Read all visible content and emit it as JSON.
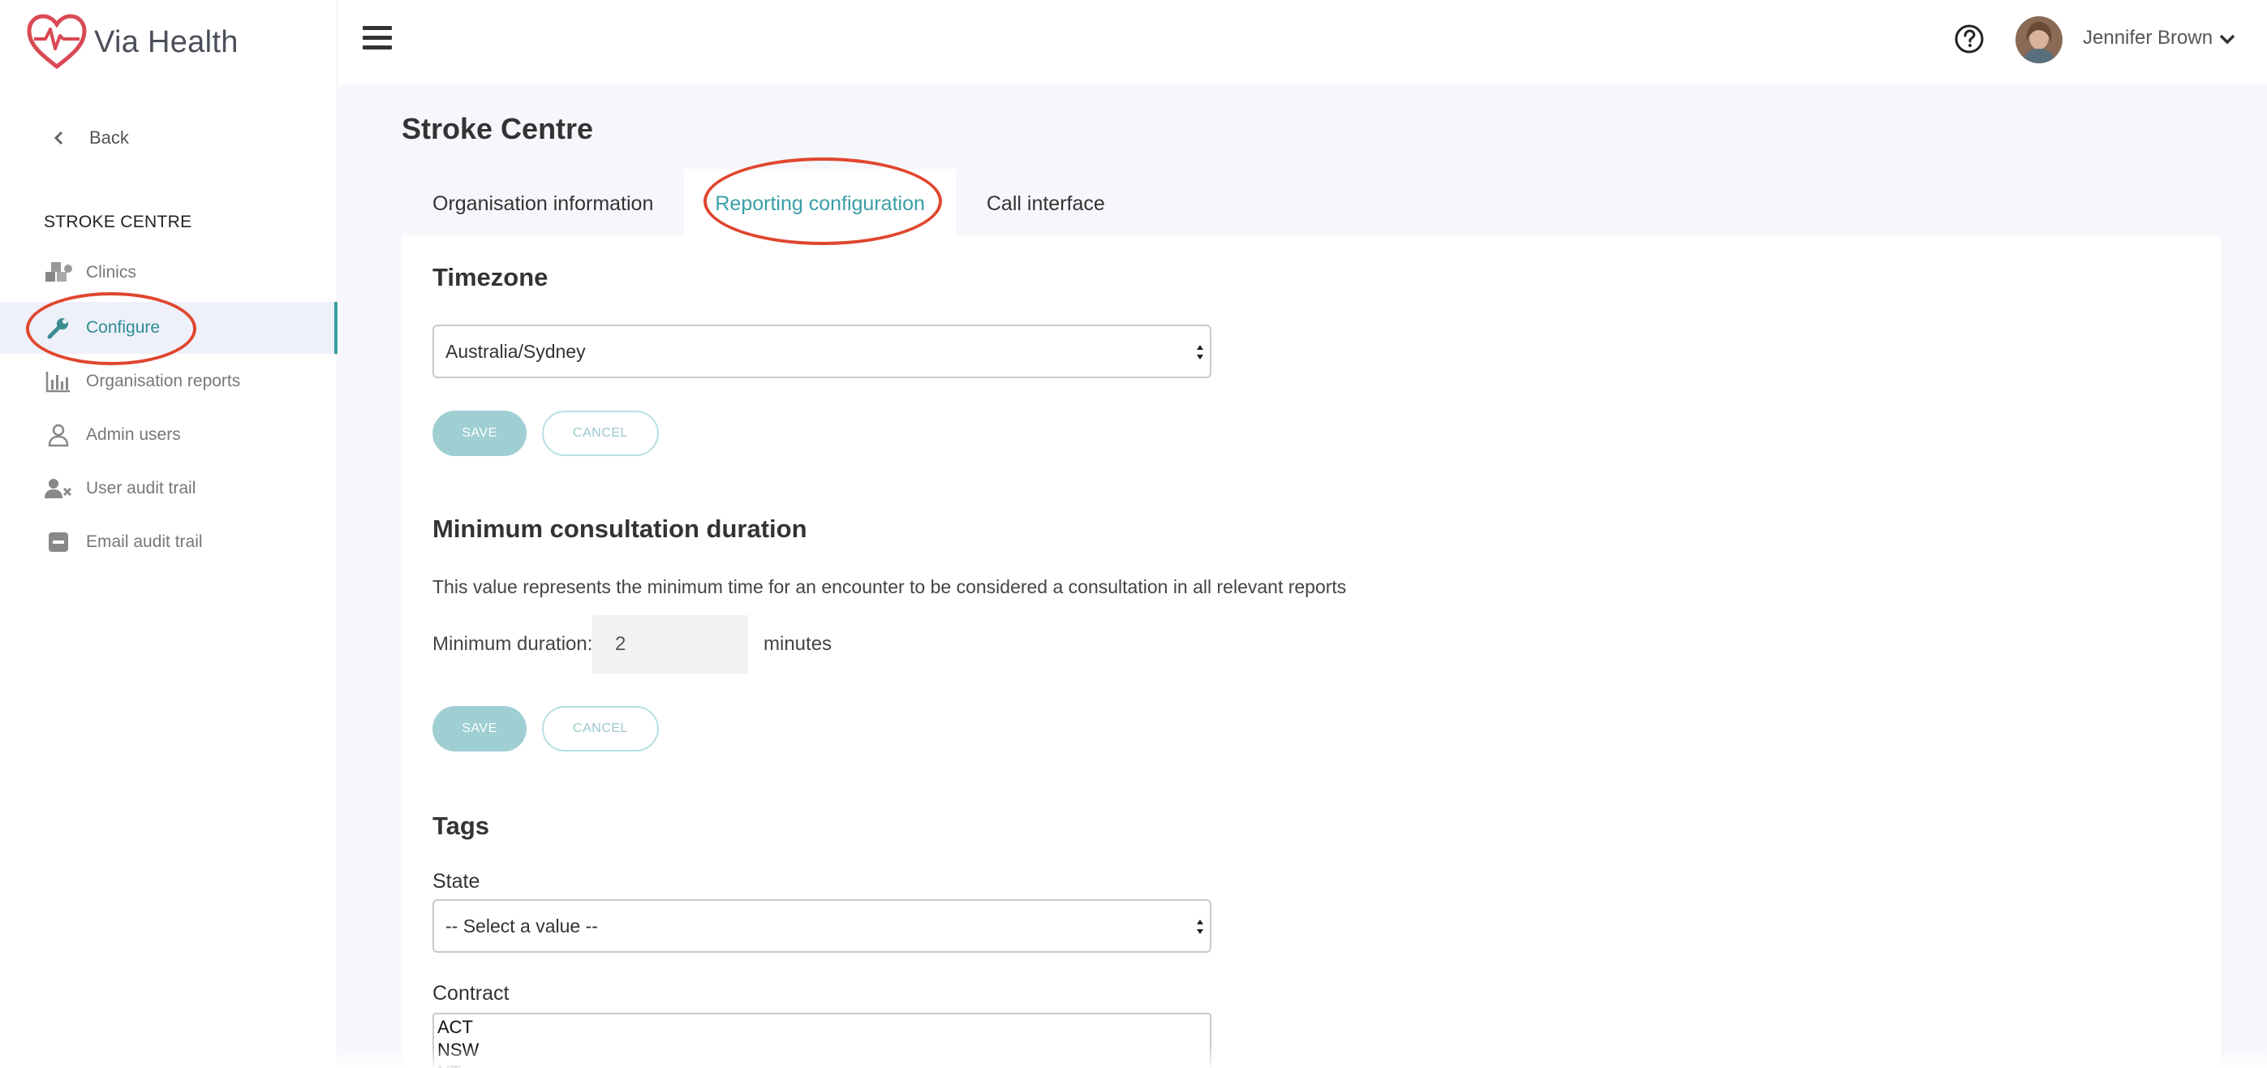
{
  "app": {
    "name": "Via Health"
  },
  "header": {
    "menu_icon": "hamburger-icon",
    "help_icon": "question-circle-icon",
    "user_name": "Jennifer Brown",
    "user_menu_icon": "chevron-down-icon"
  },
  "sidebar": {
    "back_label": "Back",
    "section_title": "STROKE CENTRE",
    "items": [
      {
        "label": "Clinics",
        "icon": "clinics-icon",
        "active": false
      },
      {
        "label": "Configure",
        "icon": "wrench-icon",
        "active": true
      },
      {
        "label": "Organisation reports",
        "icon": "bar-chart-icon",
        "active": false
      },
      {
        "label": "Admin users",
        "icon": "user-icon",
        "active": false
      },
      {
        "label": "User audit trail",
        "icon": "user-x-icon",
        "active": false
      },
      {
        "label": "Email audit trail",
        "icon": "minus-square-icon",
        "active": false
      }
    ]
  },
  "page": {
    "title": "Stroke Centre",
    "tabs": [
      {
        "label": "Organisation information",
        "active": false
      },
      {
        "label": "Reporting configuration",
        "active": true
      },
      {
        "label": "Call interface",
        "active": false
      }
    ]
  },
  "timezone": {
    "heading": "Timezone",
    "value": "Australia/Sydney",
    "save_label": "SAVE",
    "cancel_label": "CANCEL"
  },
  "min_duration": {
    "heading": "Minimum consultation duration",
    "description": "This value represents the minimum time for an encounter to be considered a consultation in all relevant reports",
    "label": "Minimum duration:",
    "value": "2",
    "unit": "minutes",
    "save_label": "SAVE",
    "cancel_label": "CANCEL"
  },
  "tags": {
    "heading": "Tags",
    "state_label": "State",
    "state_value": "-- Select a value --",
    "contract_label": "Contract",
    "contract_options": [
      "ACT",
      "NSW",
      "NT"
    ]
  },
  "colors": {
    "accent": "#3a9ea6",
    "annotation": "#e0462e",
    "logo": "#d94a54",
    "save_button": "#9fcfd2"
  }
}
